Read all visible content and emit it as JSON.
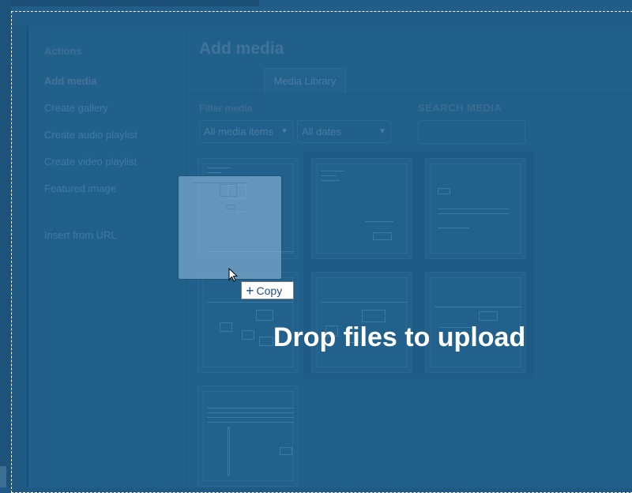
{
  "sidebar": {
    "heading": "Actions",
    "items": [
      {
        "label": "Add media"
      },
      {
        "label": "Create gallery"
      },
      {
        "label": "Create audio playlist"
      },
      {
        "label": "Create video playlist"
      },
      {
        "label": "Featured image"
      },
      {
        "label": "Insert from URL"
      }
    ]
  },
  "main": {
    "title": "Add media",
    "tabs": [
      {
        "label": "Media Library"
      }
    ],
    "filter_label": "Filter media",
    "type_filter": {
      "value": "All media items"
    },
    "date_filter": {
      "value": "All dates"
    },
    "search_label": "SEARCH MEDIA",
    "search_value": ""
  },
  "drag": {
    "badge_label": "Copy",
    "drop_text": "Drop files to upload"
  },
  "colors": {
    "overlay": "#1f5a85",
    "drop_text": "#ffffff",
    "copy_text": "#1e4f8a"
  }
}
